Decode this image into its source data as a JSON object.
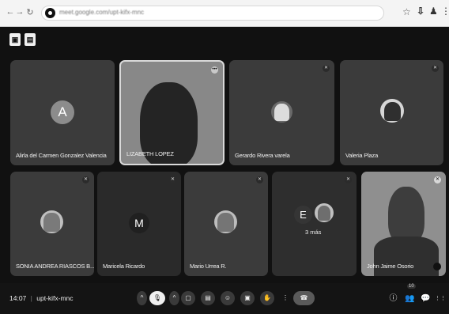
{
  "browser": {
    "url": "meet.google.com/upt-kifx-mnc",
    "back_glyph": "←",
    "forward_glyph": "→",
    "reload_glyph": "↻",
    "star_glyph": "☆",
    "download_glyph": "⇩",
    "person_glyph": "♟",
    "menu_glyph": "⋮"
  },
  "meet": {
    "topbar": {
      "first_glyph": "▣",
      "second_glyph": "▤"
    },
    "participants": [
      {
        "name": "Alirla del Carmen Gonzalez Valencia",
        "avatar": "A"
      },
      {
        "name": "LIZABETH LOPEZ",
        "avatar": ""
      },
      {
        "name": "Gerardo Rivera varela",
        "avatar": ""
      },
      {
        "name": "Valeria Plaza",
        "avatar": ""
      },
      {
        "name": "SONIA ANDREA RIASCOS B...",
        "avatar": ""
      },
      {
        "name": "Maricela Ricardo",
        "avatar": "M"
      },
      {
        "name": "Mario Urrea R.",
        "avatar": ""
      },
      {
        "name": "3 más",
        "avatar": "E"
      },
      {
        "name": "John Jaime Osorio",
        "avatar": ""
      }
    ],
    "bottom": {
      "time": "14:07",
      "separator": "|",
      "code": "upt-kifx-mnc",
      "controls": {
        "more": "^",
        "mic_off": "🎙",
        "cam_more": "^",
        "cam_off": "▢",
        "captions": "▤",
        "emoji": "☺",
        "present": "▣",
        "hand": "✋",
        "more_opts": "⋮",
        "leave": "☎"
      },
      "right": {
        "info": "ⓘ",
        "people": "👥",
        "people_badge": "10",
        "chat": "💬",
        "activities": "⋮⋮"
      }
    }
  }
}
